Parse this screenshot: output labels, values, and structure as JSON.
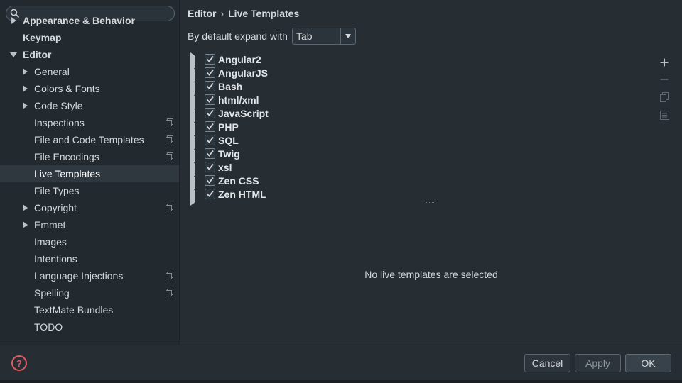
{
  "search": {
    "placeholder": "",
    "value": ""
  },
  "sidebar": {
    "items": [
      {
        "label": "Appearance & Behavior",
        "bold": true,
        "arrow": "right",
        "project": false
      },
      {
        "label": "Keymap",
        "bold": true,
        "arrow": "none",
        "project": false
      },
      {
        "label": "Editor",
        "bold": true,
        "arrow": "down",
        "project": false
      },
      {
        "label": "General",
        "bold": false,
        "arrow": "right",
        "project": false
      },
      {
        "label": "Colors & Fonts",
        "bold": false,
        "arrow": "right",
        "project": false
      },
      {
        "label": "Code Style",
        "bold": false,
        "arrow": "right",
        "project": false
      },
      {
        "label": "Inspections",
        "bold": false,
        "arrow": "none",
        "project": true
      },
      {
        "label": "File and Code Templates",
        "bold": false,
        "arrow": "none",
        "project": true
      },
      {
        "label": "File Encodings",
        "bold": false,
        "arrow": "none",
        "project": true
      },
      {
        "label": "Live Templates",
        "bold": false,
        "arrow": "none",
        "project": false,
        "selected": true
      },
      {
        "label": "File Types",
        "bold": false,
        "arrow": "none",
        "project": false
      },
      {
        "label": "Copyright",
        "bold": false,
        "arrow": "right",
        "project": true
      },
      {
        "label": "Emmet",
        "bold": false,
        "arrow": "right",
        "project": false
      },
      {
        "label": "Images",
        "bold": false,
        "arrow": "none",
        "project": false
      },
      {
        "label": "Intentions",
        "bold": false,
        "arrow": "none",
        "project": false
      },
      {
        "label": "Language Injections",
        "bold": false,
        "arrow": "none",
        "project": true
      },
      {
        "label": "Spelling",
        "bold": false,
        "arrow": "none",
        "project": true
      },
      {
        "label": "TextMate Bundles",
        "bold": false,
        "arrow": "none",
        "project": false
      },
      {
        "label": "TODO",
        "bold": false,
        "arrow": "none",
        "project": false
      }
    ]
  },
  "breadcrumb": {
    "parent": "Editor",
    "separator": "›",
    "current": "Live Templates"
  },
  "expand": {
    "label": "By default expand with",
    "value": "Tab"
  },
  "groups": [
    {
      "label": "Angular2",
      "checked": true
    },
    {
      "label": "AngularJS",
      "checked": true
    },
    {
      "label": "Bash",
      "checked": true
    },
    {
      "label": "html/xml",
      "checked": true
    },
    {
      "label": "JavaScript",
      "checked": true
    },
    {
      "label": "PHP",
      "checked": true
    },
    {
      "label": "SQL",
      "checked": true
    },
    {
      "label": "Twig",
      "checked": true
    },
    {
      "label": "xsl",
      "checked": true
    },
    {
      "label": "Zen CSS",
      "checked": true
    },
    {
      "label": "Zen HTML",
      "checked": true
    }
  ],
  "toolbar": {
    "icons": [
      "add-icon",
      "remove-icon",
      "copy-icon",
      "change-context-icon"
    ]
  },
  "empty_message": "No live templates are selected",
  "buttons": {
    "cancel": "Cancel",
    "apply": "Apply",
    "ok": "OK",
    "help": "?"
  },
  "colors": {
    "accent_check": "#d5d8dc",
    "help": "#e05a63",
    "background": "#262e34"
  }
}
